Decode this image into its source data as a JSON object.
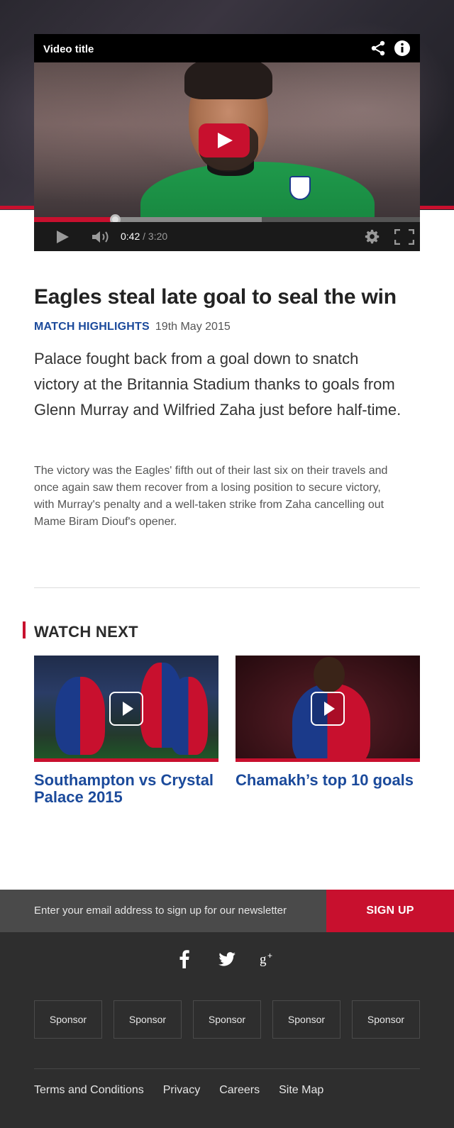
{
  "player": {
    "title": "Video title",
    "current_time": "0:42",
    "duration": "/ 3:20",
    "progress_fraction": 0.21,
    "buffered_fraction": 0.59
  },
  "article": {
    "headline": "Eagles steal late goal to seal the win",
    "category": "MATCH HIGHLIGHTS",
    "date": "19th May 2015",
    "lead": "Palace fought back from a goal down to snatch victory at the Britannia Stadium thanks to goals from Glenn Murray and Wilfried Zaha just before half-time.",
    "body": "The victory was the Eagles' fifth out of their last six on their travels and once again saw them recover from a losing position to secure victory, with Murray's penalty and a well-taken strike from Zaha cancelling out Mame Biram Diouf's opener."
  },
  "watch_next": {
    "heading": "WATCH NEXT",
    "items": [
      {
        "title": "Southampton vs Crystal Palace 2015"
      },
      {
        "title": "Chamakh’s top 10 goals"
      }
    ]
  },
  "newsletter": {
    "prompt": "Enter your email address to sign up for our newsletter",
    "button": "SIGN UP"
  },
  "social": [
    "facebook-icon",
    "twitter-icon",
    "google-plus-icon"
  ],
  "sponsors": [
    "Sponsor",
    "Sponsor",
    "Sponsor",
    "Sponsor",
    "Sponsor"
  ],
  "footer_links": [
    "Terms and Conditions",
    "Privacy",
    "Careers",
    "Site Map"
  ],
  "colors": {
    "accent_red": "#c8102e",
    "link_blue": "#1b4a9b",
    "footer_bg": "#2e2e2e",
    "newsletter_bg": "#4a4a4a"
  }
}
